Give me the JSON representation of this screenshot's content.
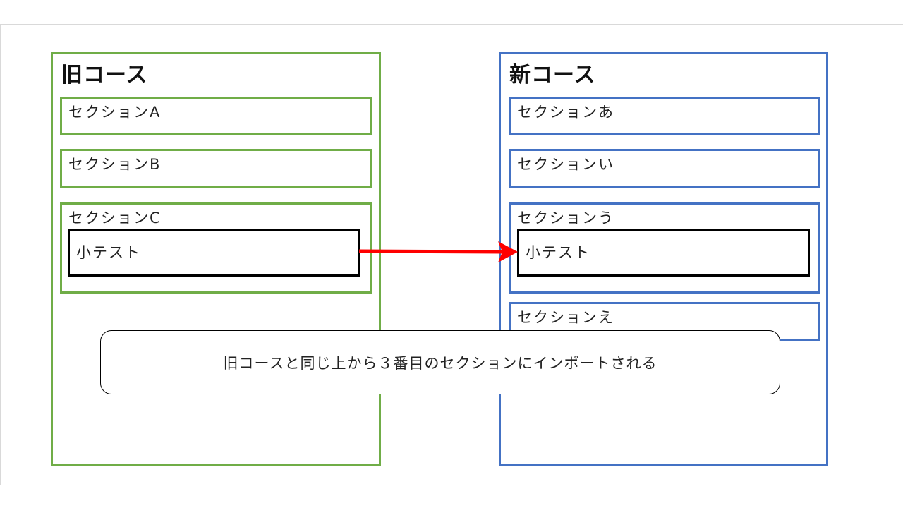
{
  "diagram": {
    "old_course": {
      "title": "旧コース",
      "color": "#70ad47",
      "sections": [
        "セクションA",
        "セクションB",
        "セクションC"
      ],
      "quiz": {
        "label": "小テスト"
      }
    },
    "new_course": {
      "title": "新コース",
      "color": "#4472c4",
      "sections": [
        "セクションあ",
        "セクションい",
        "セクションう",
        "セクションえ"
      ],
      "quiz": {
        "label": "小テスト"
      }
    },
    "arrow": {
      "color": "#ff0000"
    },
    "note": "旧コースと同じ上から３番目のセクションにインポートされる"
  }
}
